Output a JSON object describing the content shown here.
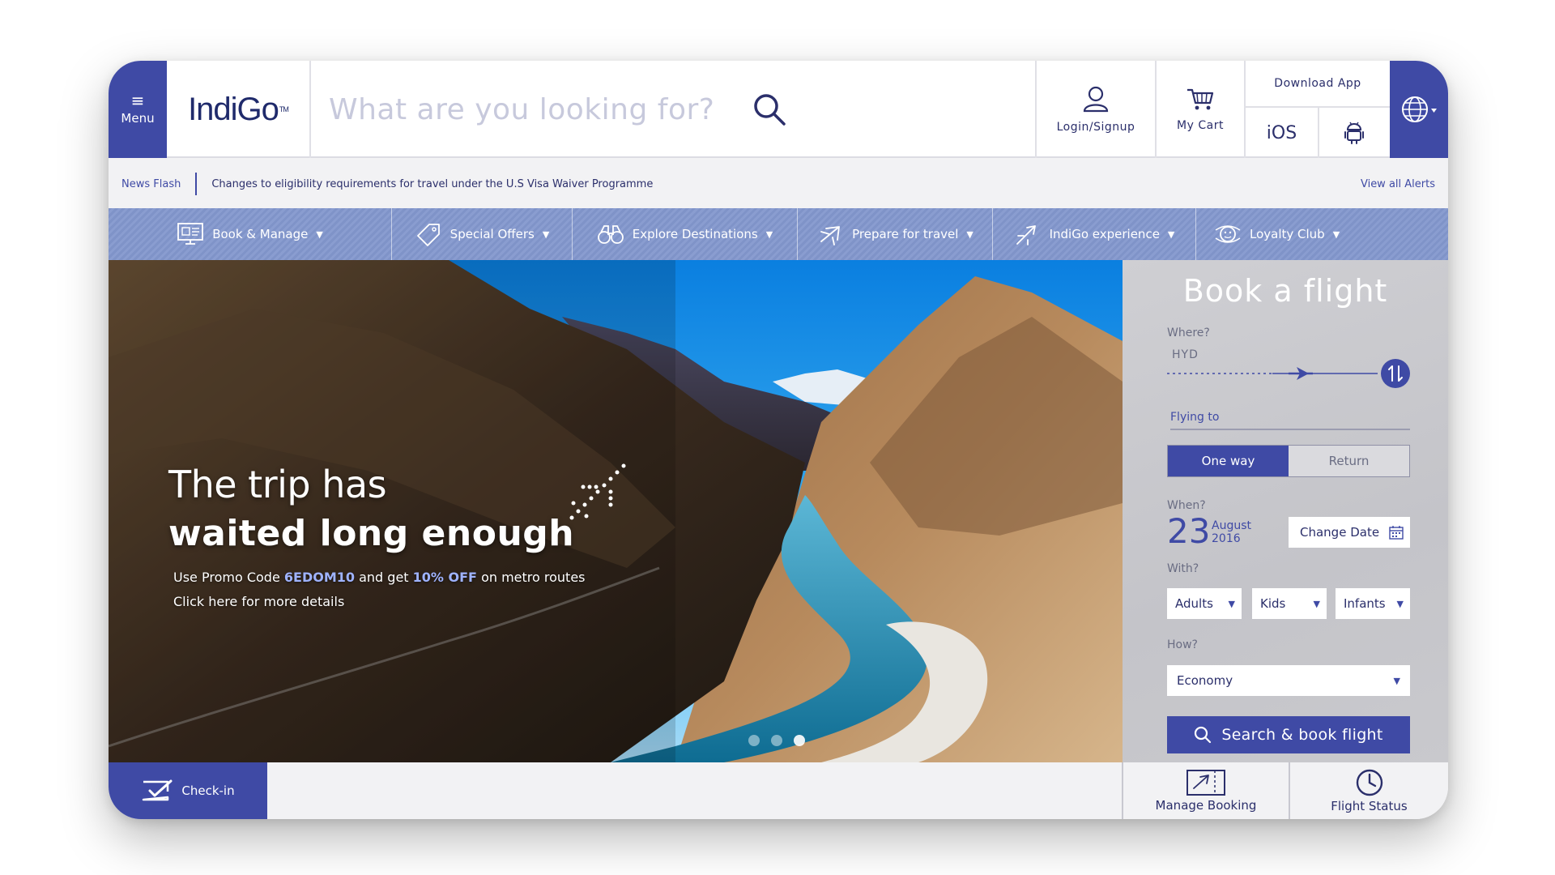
{
  "header": {
    "menu_label": "Menu",
    "logo_text": "IndiGo",
    "logo_tm": "TM",
    "search_placeholder": "What are you looking for?",
    "login_label": "Login/Signup",
    "cart_label": "My Cart",
    "download_app_label": "Download App",
    "ios_label": "iOS"
  },
  "newsbar": {
    "label": "News Flash",
    "text": "Changes to eligibility requirements for travel under the U.S Visa Waiver Programme",
    "view_all": "View all Alerts"
  },
  "nav": {
    "items": [
      {
        "label": "Book & Manage",
        "icon": "monitor-icon"
      },
      {
        "label": "Special Offers",
        "icon": "tag-icon"
      },
      {
        "label": "Explore Destinations",
        "icon": "binoculars-icon"
      },
      {
        "label": "Prepare for travel",
        "icon": "plane-icon"
      },
      {
        "label": "IndiGo experience",
        "icon": "plane-takeoff-icon"
      },
      {
        "label": "Loyalty Club",
        "icon": "loyalty-icon"
      }
    ]
  },
  "hero": {
    "heading_line1": "The trip has",
    "heading_line2": "waited long enough",
    "promo_prefix": "Use Promo Code ",
    "promo_code": "6EDOM10",
    "promo_mid": " and get ",
    "promo_discount": "10% OFF",
    "promo_suffix": " on metro routes",
    "more_link": "Click here for more details",
    "slides_total": 3,
    "active_slide": 3
  },
  "booking": {
    "title": "Book a flight",
    "where_label": "Where?",
    "from_value": "HYD",
    "to_placeholder": "Flying to",
    "trip_one_way": "One way",
    "trip_return": "Return",
    "when_label": "When?",
    "date_day": "23",
    "date_month": "August",
    "date_year": "2016",
    "change_date": "Change Date",
    "with_label": "With?",
    "adults": "Adults",
    "kids": "Kids",
    "infants": "Infants",
    "how_label": "How?",
    "cabin": "Economy",
    "search_button": "Search & book flight"
  },
  "bottom": {
    "checkin": "Check-in",
    "manage_booking": "Manage Booking",
    "flight_status": "Flight Status"
  },
  "colors": {
    "brand": "#3f4aa5",
    "nav": "#8a9dd0",
    "panel": "#c9c9cd"
  }
}
